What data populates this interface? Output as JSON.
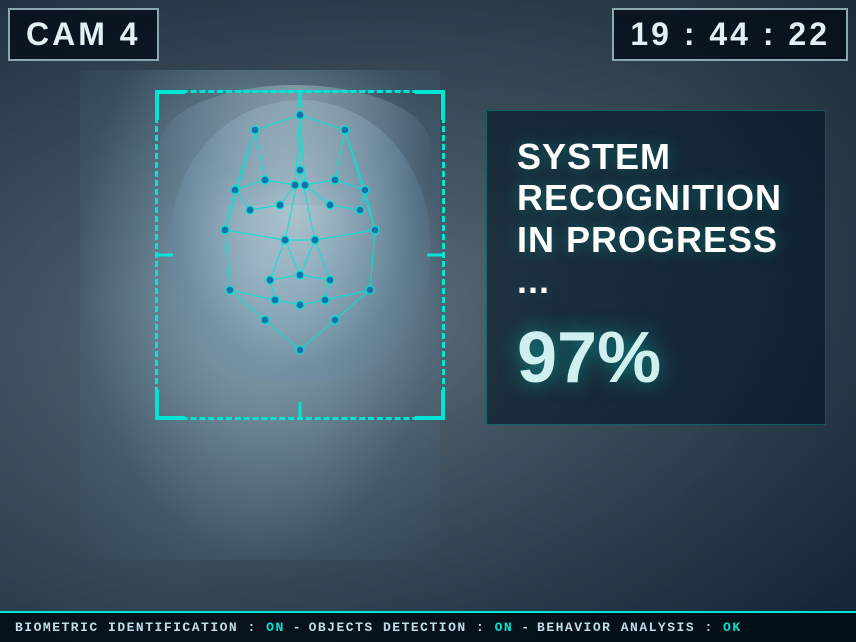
{
  "camera": {
    "label": "CAM 4",
    "timestamp": "19 : 44 : 22"
  },
  "recognition": {
    "status_line1": "SYSTEM",
    "status_line2": "RECOGNITION",
    "status_line3": "IN PROGRESS ...",
    "progress": "97%"
  },
  "status_bar": {
    "biometric_label": "BIOMETRIC IDENTIFICATION",
    "biometric_value": "ON",
    "separator1": " - ",
    "objects_label": "OBJECTS DETECTION",
    "objects_value": "ON",
    "separator2": " - ",
    "behavior_label": "BEHAVIOR ANALYSIS",
    "behavior_value": "OK"
  }
}
